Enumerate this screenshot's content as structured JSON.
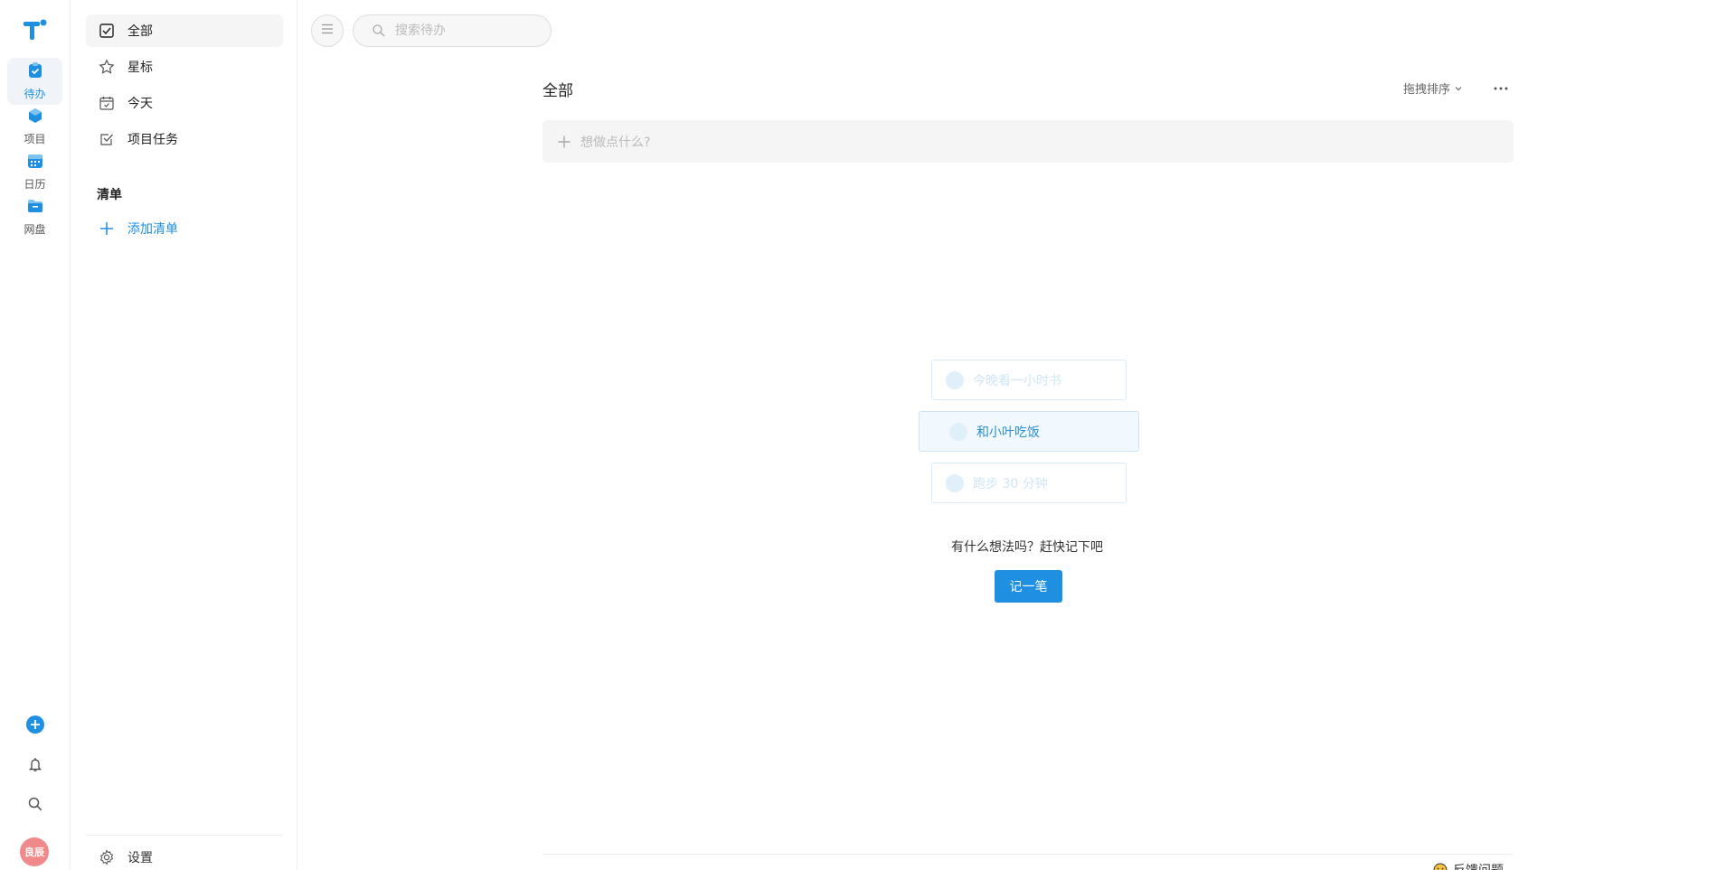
{
  "rail": {
    "items": [
      {
        "label": "待办",
        "icon": "todo-icon"
      },
      {
        "label": "项目",
        "icon": "project-icon"
      },
      {
        "label": "日历",
        "icon": "calendar-icon"
      },
      {
        "label": "网盘",
        "icon": "folder-icon"
      }
    ],
    "avatar_text": "良辰",
    "accent": "#1e8fe1"
  },
  "sidebar": {
    "items": [
      {
        "label": "全部",
        "icon": "checkbox-icon",
        "active": true
      },
      {
        "label": "星标",
        "icon": "star-icon"
      },
      {
        "label": "今天",
        "icon": "calendar-today-icon"
      },
      {
        "label": "项目任务",
        "icon": "task-check-icon"
      }
    ],
    "section_title": "清单",
    "add_list_label": "添加清单",
    "settings_label": "设置"
  },
  "search": {
    "placeholder": "搜索待办"
  },
  "main": {
    "title": "全部",
    "sort_label": "拖拽排序",
    "add_placeholder": "想做点什么?"
  },
  "empty_state": {
    "cards": [
      "今晚看一小时书",
      "和小叶吃饭",
      "跑步 30 分钟"
    ],
    "message": "有什么想法吗？赶快记下吧",
    "cta_label": "记一笔"
  },
  "footer": {
    "feedback_label": "反馈问题"
  }
}
